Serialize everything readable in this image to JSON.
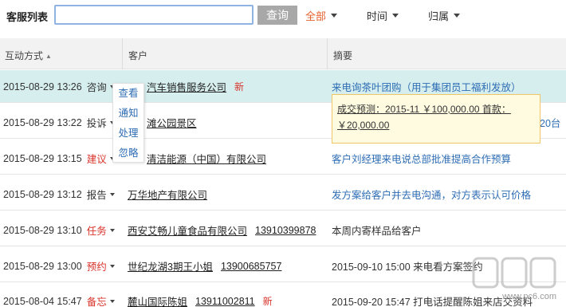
{
  "toolbar": {
    "title": "客服列表",
    "search_value": "",
    "search_button": "查询",
    "filters": [
      {
        "label": "全部",
        "active": true
      },
      {
        "label": "时间",
        "active": false
      },
      {
        "label": "归属",
        "active": false
      }
    ]
  },
  "table": {
    "headers": [
      "互动方式",
      "客户",
      "摘要"
    ],
    "rows": [
      {
        "date": "2015-08-29 13:26",
        "type": "咨询",
        "type_red": false,
        "customer": "汽车销售服务公司",
        "phone": "",
        "new": "新",
        "summary": "来电询茶叶团购（用于集团员工福利发放）",
        "summary_blue": true
      },
      {
        "date": "2015-08-29 13:22",
        "type": "投诉",
        "type_red": false,
        "customer": "滩公园景区",
        "phone": "",
        "new": "",
        "summary": "20台",
        "summary_blue": true
      },
      {
        "date": "2015-08-29 13:15",
        "type": "建议",
        "type_red": true,
        "customer": "清洁能源（中国）有限公司",
        "phone": "",
        "new": "",
        "summary": "客户刘经理来电说总部批准提高合作预算",
        "summary_blue": true
      },
      {
        "date": "2015-08-29 13:12",
        "type": "报告",
        "type_red": false,
        "customer": "万华地产有限公司",
        "phone": "",
        "new": "",
        "summary": "发方案给客户并去电沟通，对方表示认可价格",
        "summary_blue": true
      },
      {
        "date": "2015-08-29 13:10",
        "type": "任务",
        "type_red": true,
        "customer": "西安艾畅儿童食品有限公司",
        "phone": "13910399878",
        "new": "",
        "summary": "本周内寄样品给客户",
        "summary_blue": false
      },
      {
        "date": "2015-08-29 13:00",
        "type": "预约",
        "type_red": true,
        "customer": "世纪龙湖3期王小姐",
        "phone": "13900685757",
        "new": "",
        "summary": "2015-09-10 15:00 来电看方案签约",
        "summary_blue": false
      },
      {
        "date": "2015-08-04 15:47",
        "type": "备忘",
        "type_red": true,
        "customer": "麓山国际陈姐",
        "phone": "13911002811",
        "new": "新",
        "summary": "2015-09-20 15:47 打电话提醒陈姐来店交资料",
        "summary_blue": false
      }
    ]
  },
  "action_menu": [
    "查看",
    "通知",
    "处理",
    "忽略"
  ],
  "tooltip": {
    "line1": "成交预测：2015-11 ￥100,000.00 首款：",
    "line2": "￥20,000.00"
  },
  "watermark": "www.pc6.com"
}
